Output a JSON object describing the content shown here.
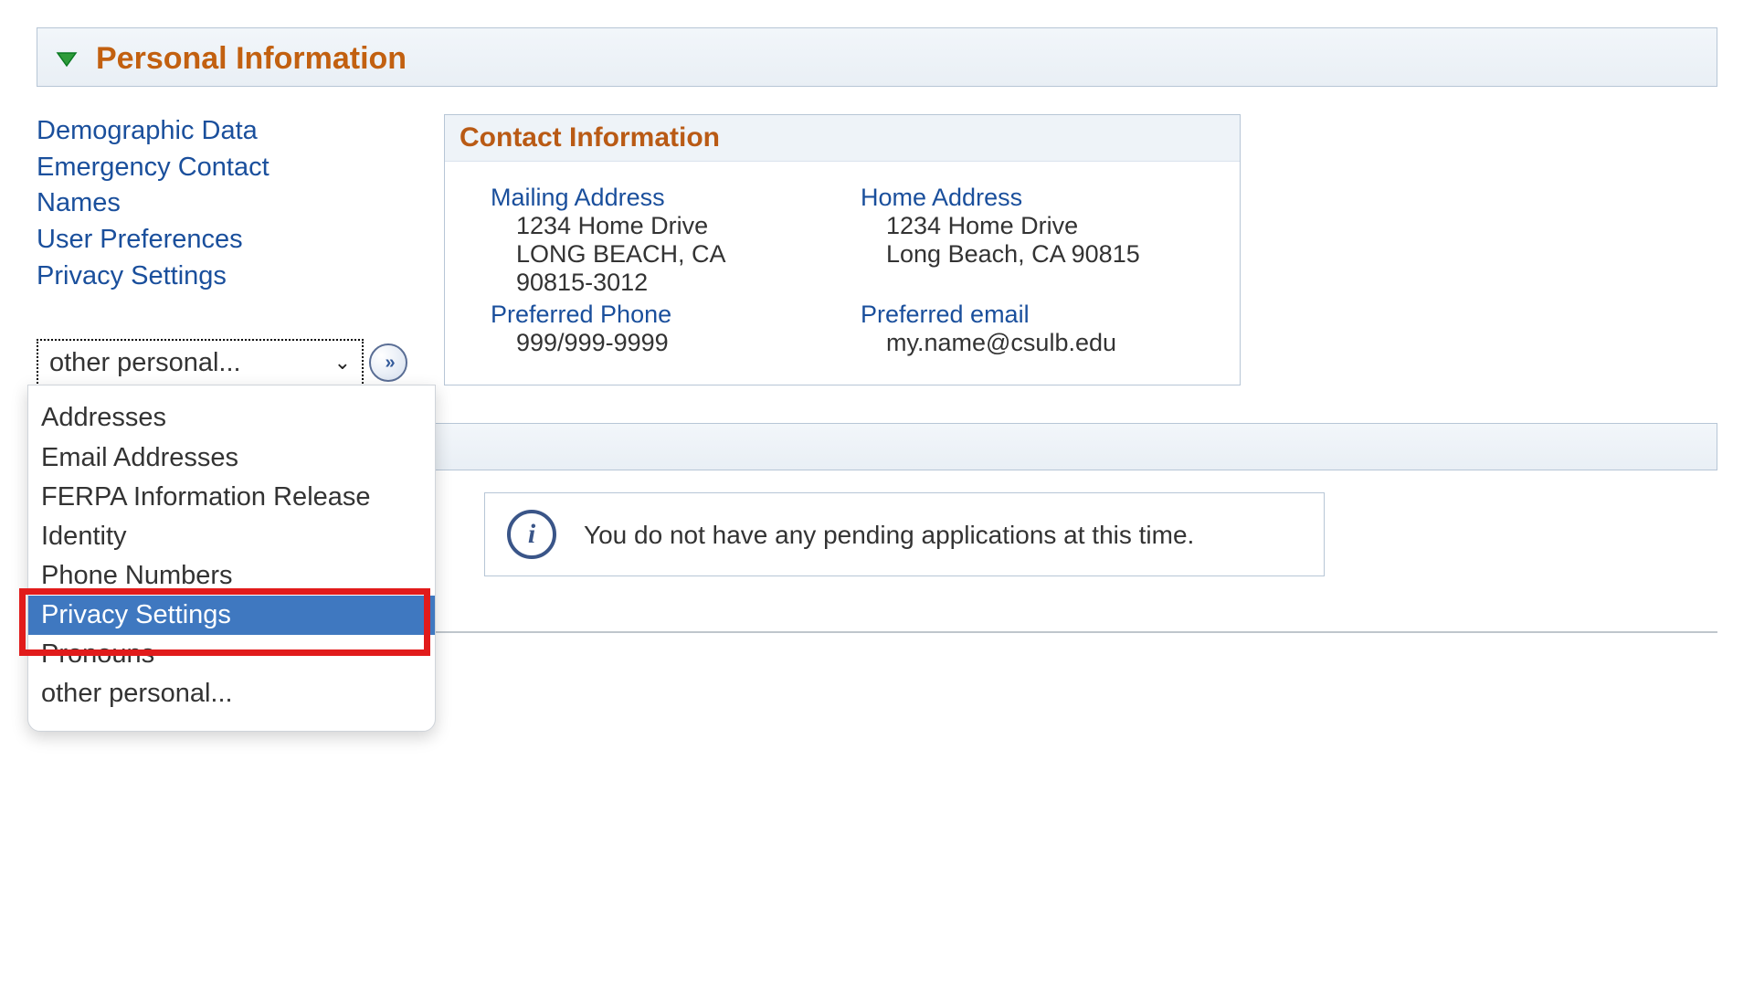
{
  "section": {
    "title": "Personal Information"
  },
  "nav": {
    "items": [
      {
        "label": "Demographic Data"
      },
      {
        "label": "Emergency Contact"
      },
      {
        "label": "Names"
      },
      {
        "label": "User Preferences"
      },
      {
        "label": "Privacy Settings"
      }
    ]
  },
  "dropdown": {
    "selected": "other personal...",
    "options": [
      "Addresses",
      "Email Addresses",
      "FERPA Information Release",
      "Identity",
      "Phone Numbers",
      "Privacy Settings",
      "Pronouns",
      "other personal..."
    ],
    "highlighted_index": 5
  },
  "contact_panel": {
    "title": "Contact Information",
    "mailing": {
      "label": "Mailing Address",
      "line1": "1234 Home Drive",
      "line2": "LONG BEACH, CA",
      "line3": "90815-3012"
    },
    "home": {
      "label": "Home Address",
      "line1": "1234 Home Drive",
      "line2": "Long Beach, CA 90815"
    },
    "phone": {
      "label": "Preferred Phone",
      "value": "999/999-9999"
    },
    "email": {
      "label": "Preferred email",
      "value": "my.name@csulb.edu"
    }
  },
  "app_status": {
    "message": "You do not have any pending applications at this time."
  },
  "glyphs": {
    "go": "»",
    "caret": "⌄",
    "info": "i"
  }
}
